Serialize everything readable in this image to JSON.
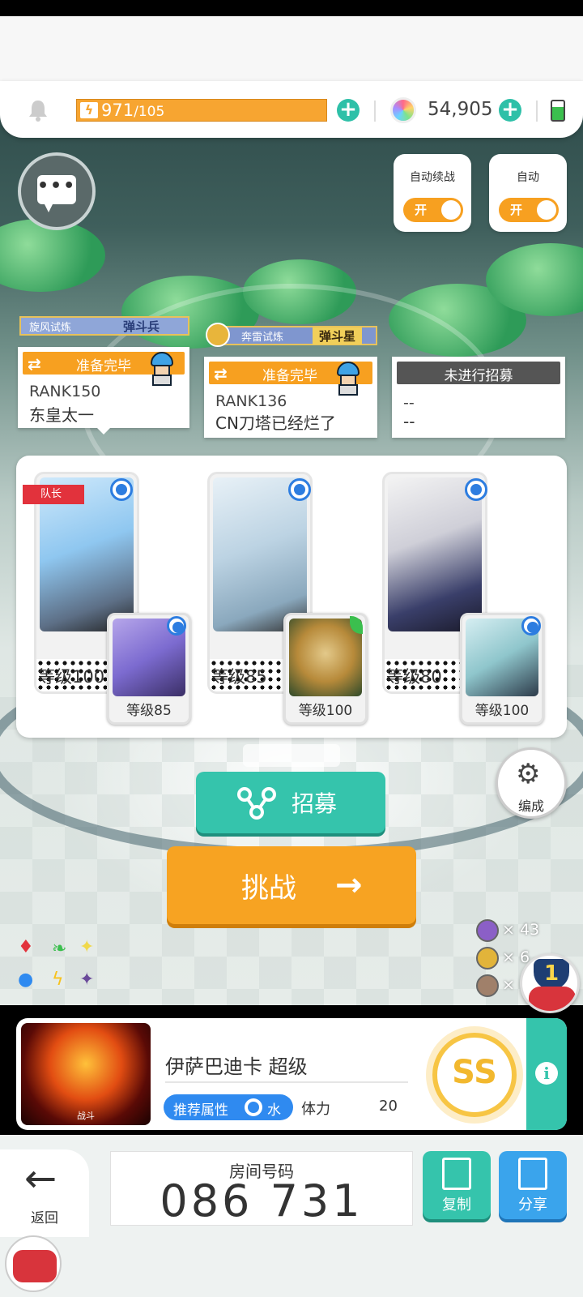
{
  "header": {
    "energy_current": "971",
    "energy_max": "/105",
    "gem_count": "54,905",
    "energy_icon_glyph": "ϟ",
    "plus_glyph": "+"
  },
  "chat": {
    "dots": "•••"
  },
  "toggles": [
    {
      "label": "自动续战",
      "state": "开"
    },
    {
      "label": "自动",
      "state": "开"
    }
  ],
  "trials": [
    {
      "name": "旋风试炼",
      "rank_title": "弹斗兵"
    },
    {
      "name": "奔雷试炼",
      "rank_title": "弹斗星"
    }
  ],
  "players": [
    {
      "status": "准备完毕",
      "rank": "RANK150",
      "name": "东皇太一"
    },
    {
      "status": "准备完毕",
      "rank": "RANK136",
      "name": "CN刀塔已经烂了"
    },
    {
      "status": "未进行招募",
      "rank": "--",
      "name": "--"
    }
  ],
  "status_icon_glyph": "⇄",
  "team": {
    "leader_label": "队长",
    "characters": [
      {
        "main_level": "等级100",
        "sub_level": "等级85"
      },
      {
        "main_level": "等级85",
        "sub_level": "等级100"
      },
      {
        "main_level": "等级80",
        "sub_level": "等级100"
      }
    ]
  },
  "actions": {
    "recruit_label": "招募",
    "challenge_label": "挑战",
    "challenge_arrow": "→",
    "edit_label": "编成",
    "edit_icon": "⚙"
  },
  "elements": [
    "♦",
    "❧",
    "✦",
    "●",
    "ϟ",
    "✦"
  ],
  "medals": [
    {
      "count": "× 43",
      "color": "#8b5fc7"
    },
    {
      "count": "× 6",
      "color": "#e2b43a"
    },
    {
      "count": "×",
      "color": "#a0806a"
    }
  ],
  "notification": {
    "count": "1"
  },
  "boss": {
    "thumb_label": "战斗",
    "name": "伊萨巴迪卡 超级",
    "attr_label": "推荐属性",
    "attr_value": "水",
    "stamina_label": "体力",
    "stamina_value": "20",
    "rank": "SS",
    "info_glyph": "i"
  },
  "room": {
    "back_label": "返回",
    "back_arrow": "←",
    "label": "房间号码",
    "number": "086 731",
    "copy_label": "复制",
    "share_label": "分享"
  },
  "colors": {
    "accent_orange": "#f7a020",
    "accent_teal": "#35c4ac",
    "accent_blue": "#3aa4ec",
    "leader_red": "#e2323c"
  }
}
